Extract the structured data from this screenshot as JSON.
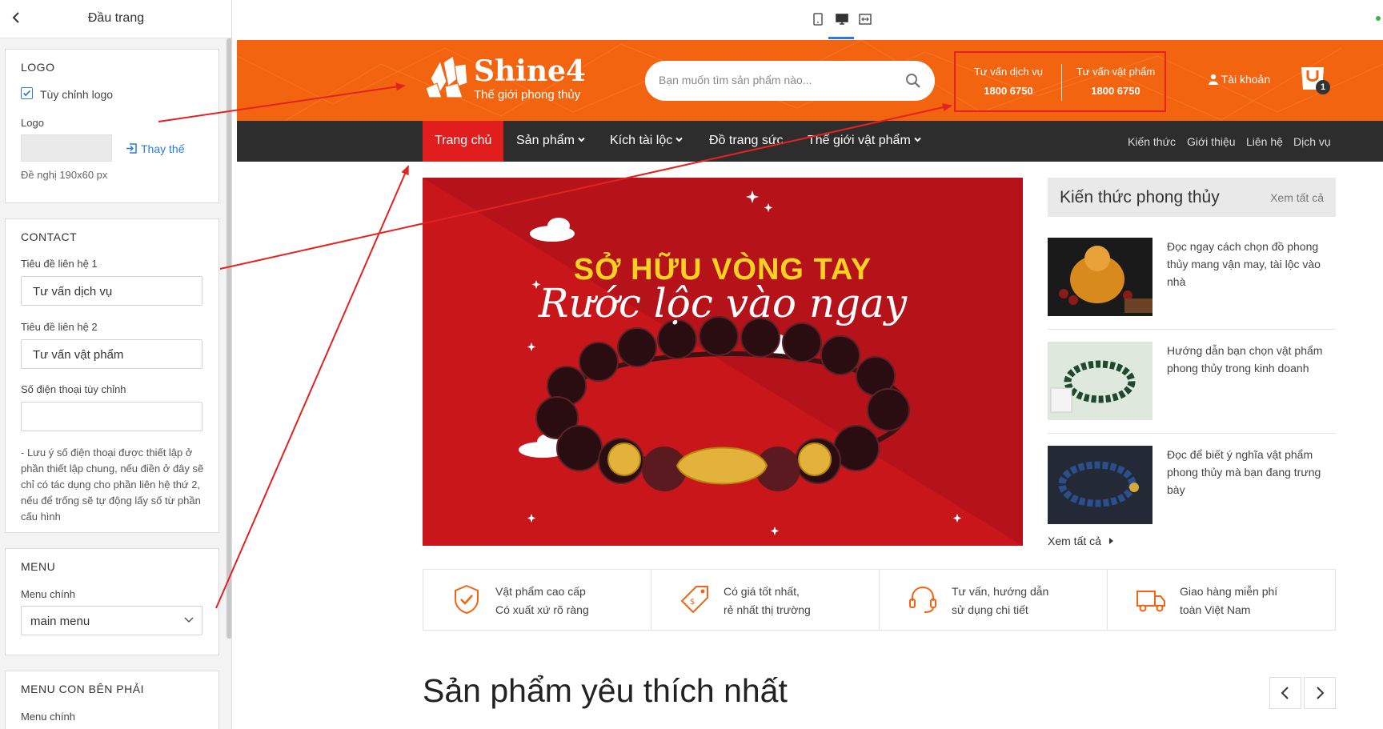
{
  "panel": {
    "title": "Đầu trang",
    "logo_section": {
      "heading": "LOGO",
      "custom_logo_label": "Tùy chỉnh logo",
      "custom_logo_checked": true,
      "logo_label": "Logo",
      "replace_label": "Thay thế",
      "hint": "Đề nghị 190x60 px"
    },
    "contact_section": {
      "heading": "CONTACT",
      "title1_label": "Tiêu đề liên hệ 1",
      "title1_value": "Tư vấn dịch vụ",
      "title2_label": "Tiêu đề liên hệ 2",
      "title2_value": "Tư vấn vật phẩm",
      "phone_label": "Số điện thoại tùy chỉnh",
      "phone_value": "",
      "note": "- Lưu ý số điện thoại được thiết lập ở phần thiết lập chung, nếu điền ở đây sẽ chỉ có tác dụng cho phần liên hệ thứ 2, nếu để trống sẽ tự động lấy số từ phần cấu hình"
    },
    "menu_section": {
      "heading": "MENU",
      "main_menu_label": "Menu chính",
      "main_menu_value": "main menu"
    },
    "submenu_section": {
      "heading": "MENU CON BÊN PHẢI",
      "main_menu_label": "Menu chính"
    }
  },
  "device_toolbar": {
    "icons": [
      "tablet-icon",
      "desktop-icon",
      "fullwidth-icon"
    ],
    "active": "desktop-icon"
  },
  "site": {
    "brand": "Shine4",
    "tagline": "Thế giới phong thủy",
    "search_placeholder": "Bạn muốn tìm sản phẩm nào...",
    "contact1": {
      "title": "Tư vấn dịch vụ",
      "phone": "1800 6750"
    },
    "contact2": {
      "title": "Tư vấn vật phẩm",
      "phone": "1800 6750"
    },
    "account_label": "Tài khoản",
    "cart_count": "1",
    "nav": [
      "Trang chủ",
      "Sản phẩm",
      "Kích tài lộc",
      "Đồ trang sức",
      "Thế giới vật phẩm"
    ],
    "nav_right": [
      "Kiến thức",
      "Giới thiệu",
      "Liên hệ",
      "Dịch vụ"
    ],
    "banner": {
      "line1": "SỞ HỮU VÒNG TAY",
      "line2": "Rước lộc vào ngay"
    },
    "knowledge": {
      "title": "Kiến thức phong thủy",
      "see_all": "Xem tất cả",
      "articles": [
        "Đọc ngay cách chọn đồ phong thủy mang vận may, tài lộc vào nhà",
        "Hướng dẫn bạn chọn vật phẩm phong thủy trong kinh doanh",
        "Đọc để biết ý nghĩa vật phẩm phong thủy mà bạn đang trưng bày"
      ],
      "more": "Xem tất cả"
    },
    "features": [
      {
        "l1": "Vật phẩm cao cấp",
        "l2": "Có xuất xứ rõ ràng",
        "icon": "shield-check-icon"
      },
      {
        "l1": "Có giá tốt nhất,",
        "l2": "rẻ nhất thị trường",
        "icon": "price-tag-icon"
      },
      {
        "l1": "Tư vấn, hướng dẫn",
        "l2": "sử dụng chi tiết",
        "icon": "headset-icon"
      },
      {
        "l1": "Giao hàng miễn phí",
        "l2": "toàn Việt Nam",
        "icon": "truck-icon"
      }
    ],
    "favorites_title": "Sản phẩm yêu thích nhất"
  },
  "colors": {
    "brand_orange": "#f26410",
    "nav_dark": "#2d2d2d",
    "nav_active": "#e11d1d",
    "banner_red": "#c8161b",
    "annotation": "#e32222"
  }
}
